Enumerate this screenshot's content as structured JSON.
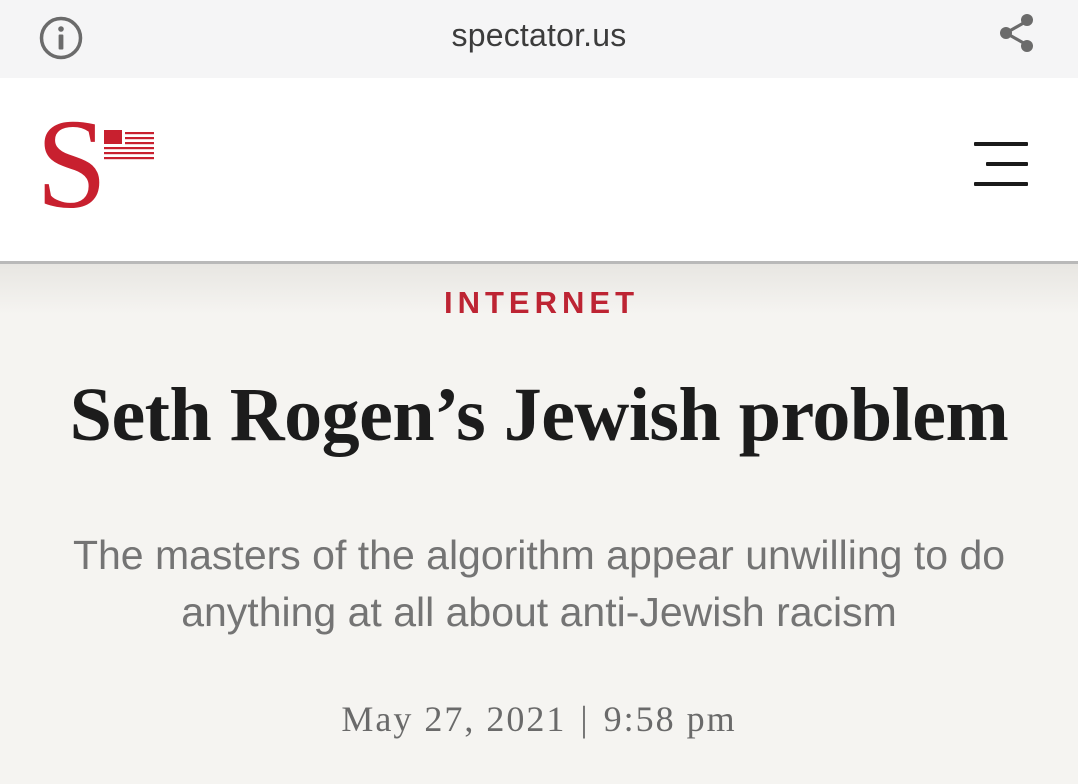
{
  "browser": {
    "domain": "spectator.us",
    "icons": {
      "info": "info-icon",
      "share": "share-icon"
    }
  },
  "site": {
    "logo_letter": "S",
    "brand_color": "#c8202f",
    "menu_icon": "hamburger-menu-icon"
  },
  "article": {
    "section": "INTERNET",
    "title": "Seth Rogen’s Jewish problem",
    "subtitle": "The masters of the algorithm appear unwilling to do anything at all about anti-Jewish racism",
    "date": "May 27, 2021",
    "separator": "|",
    "time": "9:58 pm"
  },
  "colors": {
    "accent": "#bd2433",
    "title": "#1c1c1c",
    "subtitle": "#747474",
    "background": "#f5f4f1"
  }
}
